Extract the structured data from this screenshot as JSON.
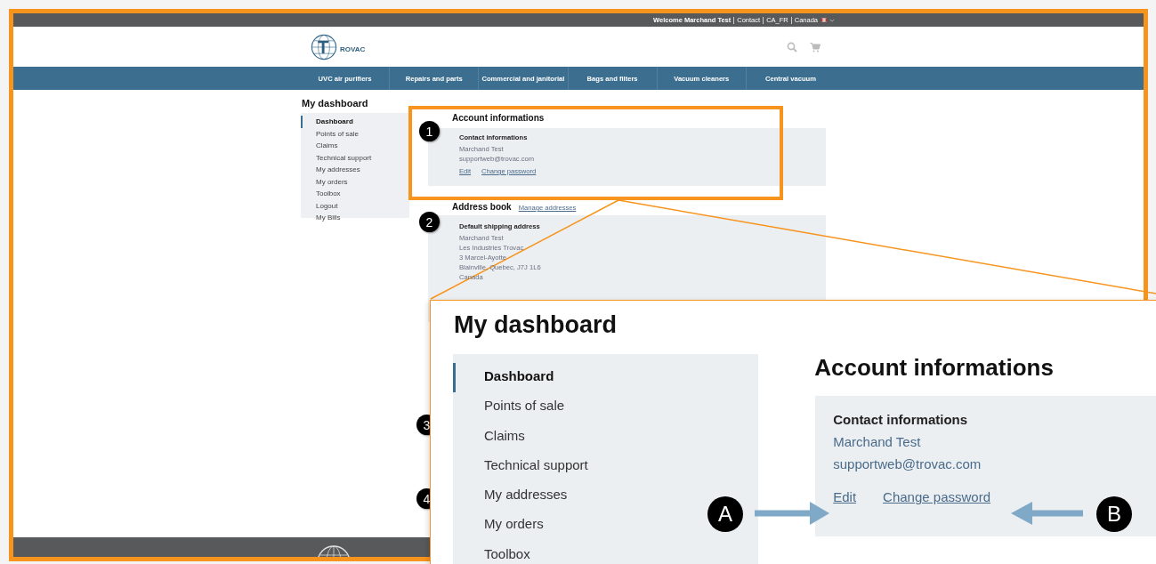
{
  "top_bar": {
    "welcome": "Welcome Marchand Test",
    "links": [
      "Contact",
      "CA_FR",
      "Canada"
    ]
  },
  "logo": {
    "initial": "T",
    "rest": "ROVAC"
  },
  "nav": [
    "UVC air purifiers",
    "Repairs and parts",
    "Commercial and janitorial",
    "Bags and filters",
    "Vacuum cleaners",
    "Central vacuum"
  ],
  "page_title": "My dashboard",
  "sidebar": [
    {
      "label": "Dashboard",
      "selected": true
    },
    {
      "label": "Points of sale",
      "selected": false
    },
    {
      "label": "Claims",
      "selected": false
    },
    {
      "label": "Technical support",
      "selected": false
    },
    {
      "label": "My addresses",
      "selected": false
    },
    {
      "label": "My orders",
      "selected": false
    },
    {
      "label": "Toolbox",
      "selected": false
    },
    {
      "label": "Logout",
      "selected": false
    },
    {
      "label": "My Bills",
      "selected": false
    }
  ],
  "account": {
    "title": "Account informations",
    "card_title": "Contact informations",
    "name": "Marchand Test",
    "email": "supportweb@trovac.com",
    "links": [
      "Edit",
      "Change password"
    ]
  },
  "address_book": {
    "title": "Address book",
    "manage_link": "Manage addresses",
    "card_title": "Default shipping address",
    "lines": [
      "Marchand Test",
      "Les Industries Trovac",
      "3 Marcel-Ayotte",
      "Blainville, Quebec, J7J 1L6",
      "Canada"
    ]
  },
  "callouts": [
    "1",
    "2",
    "3",
    "4"
  ],
  "zoom_inset": {
    "page_title": "My dashboard",
    "sidebar": [
      {
        "label": "Dashboard",
        "selected": true
      },
      {
        "label": "Points of sale",
        "selected": false
      },
      {
        "label": "Claims",
        "selected": false
      },
      {
        "label": "Technical support",
        "selected": false
      },
      {
        "label": "My addresses",
        "selected": false
      },
      {
        "label": "My orders",
        "selected": false
      },
      {
        "label": "Toolbox",
        "selected": false
      }
    ],
    "account": {
      "title": "Account informations",
      "card_title": "Contact informations",
      "name": "Marchand Test",
      "email": "supportweb@trovac.com",
      "links": [
        "Edit",
        "Change password"
      ]
    },
    "callouts": [
      "A",
      "B"
    ]
  }
}
